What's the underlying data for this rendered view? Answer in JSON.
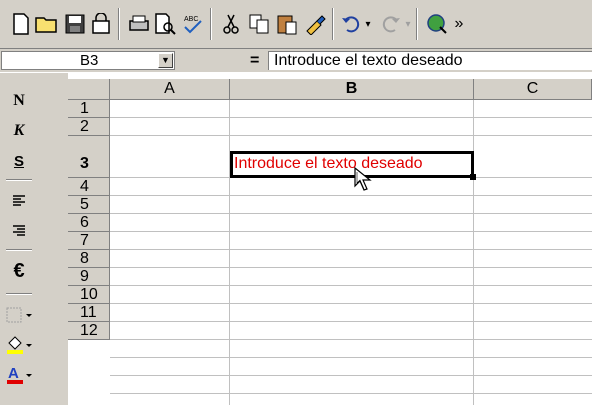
{
  "toolbar": {
    "icons": [
      "new-document-icon",
      "open-folder-icon",
      "save-icon",
      "permissions-icon",
      "print-icon",
      "print-preview-icon",
      "spelling-icon",
      "cut-icon",
      "copy-icon",
      "paste-icon",
      "format-painter-icon",
      "undo-icon",
      "redo-icon",
      "hyperlink-icon"
    ]
  },
  "formula_bar": {
    "name_box": "B3",
    "equals": "=",
    "formula": "Introduce el texto deseado"
  },
  "format_toolbar": {
    "bold": "N",
    "italic": "K",
    "underline": "S",
    "currency": "€"
  },
  "sheet": {
    "columns": [
      "A",
      "B",
      "C"
    ],
    "rows": [
      "1",
      "2",
      "3",
      "4",
      "5",
      "6",
      "7",
      "8",
      "9",
      "10",
      "11",
      "12"
    ],
    "active_cell": "B3",
    "active_cell_text": "Introduce el texto deseado",
    "active_text_color": "#e00000"
  }
}
